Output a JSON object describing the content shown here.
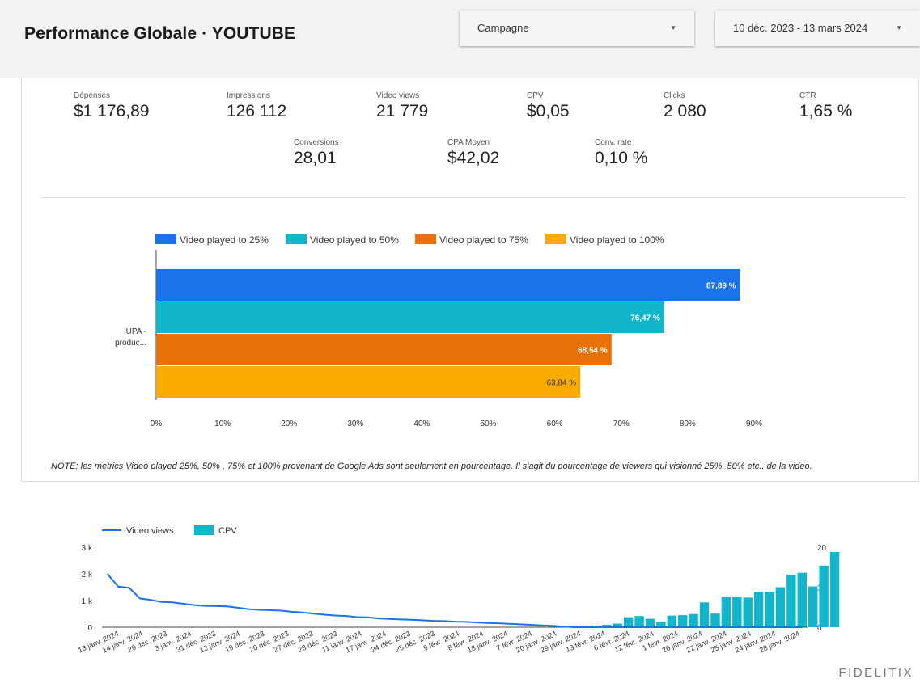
{
  "header": {
    "title": "Performance Globale · YOUTUBE",
    "campaign_dropdown": "Campagne",
    "date_dropdown": "10 déc. 2023 - 13 mars 2024"
  },
  "kpis": [
    {
      "label": "Dépenses",
      "value": "$1 176,89"
    },
    {
      "label": "Impressions",
      "value": "126 112"
    },
    {
      "label": "Video views",
      "value": "21 779"
    },
    {
      "label": "CPV",
      "value": "$0,05"
    },
    {
      "label": "Clicks",
      "value": "2 080"
    },
    {
      "label": "CTR",
      "value": "1,65 %"
    },
    {
      "label": "Conversions",
      "value": "28,01"
    },
    {
      "label": "CPA Moyen",
      "value": "$42,02"
    },
    {
      "label": "Conv. rate",
      "value": "0,10 %"
    }
  ],
  "note": "NOTE: les metrics Video played 25%, 50% , 75% et 100% provenant de Google Ads sont seulement en pourcentage. Il s'agit du pourcentage de viewers qui visionné 25%, 50% etc.. de la video.",
  "brand": "FIDELITIX",
  "chart_data": [
    {
      "type": "bar",
      "orientation": "horizontal",
      "categories": [
        "UPA - produc..."
      ],
      "series": [
        {
          "name": "Video played to 25%",
          "values": [
            87.89
          ],
          "label": "87,89 %",
          "color": "#1a73e8"
        },
        {
          "name": "Video played to 50%",
          "values": [
            76.47
          ],
          "label": "76,47 %",
          "color": "#12b5cb"
        },
        {
          "name": "Video played to 75%",
          "values": [
            68.54
          ],
          "label": "68,54 %",
          "color": "#e8710a"
        },
        {
          "name": "Video played to 100%",
          "values": [
            63.84
          ],
          "label": "63,84 %",
          "color": "#f9ab00"
        }
      ],
      "xlim": [
        0,
        90
      ],
      "xticks": [
        "0%",
        "10%",
        "20%",
        "30%",
        "40%",
        "50%",
        "60%",
        "70%",
        "80%",
        "90%"
      ],
      "legend": "top"
    },
    {
      "type": "combo",
      "categories": [
        "13 janv. 2024",
        "14 janv. 2024",
        "29 déc. 2023",
        "3 janv. 2024",
        "31 déc. 2023",
        "12 janv. 2024",
        "19 déc. 2023",
        "20 déc. 2023",
        "27 déc. 2023",
        "28 déc. 2023",
        "11 janv. 2024",
        "17 janv. 2024",
        "24 déc. 2023",
        "25 déc. 2023",
        "9 févr. 2024",
        "8 févr. 2024",
        "18 janv. 2024",
        "7 févr. 2024",
        "20 janv. 2024",
        "29 janv. 2024",
        "13 févr. 2024",
        "6 févr. 2024",
        "12 févr. 2024",
        "1 févr. 2024",
        "26 janv. 2024",
        "22 janv. 2024",
        "25 janv. 2024",
        "24 janv. 2024",
        "28 janv. 2024"
      ],
      "series": [
        {
          "name": "Video views",
          "type": "line",
          "axis": "left",
          "color": "#1a73e8",
          "values": [
            2000,
            1520,
            1480,
            1080,
            1020,
            950,
            930,
            880,
            830,
            800,
            790,
            780,
            730,
            680,
            650,
            640,
            620,
            580,
            550,
            510,
            470,
            440,
            420,
            380,
            370,
            330,
            310,
            290,
            280,
            260,
            240,
            230,
            210,
            200,
            180,
            160,
            150,
            130,
            110,
            90,
            70,
            50,
            20,
            0,
            0,
            0,
            0,
            0,
            0,
            0,
            0,
            0,
            0,
            0,
            0,
            0,
            0,
            0,
            0,
            0,
            0,
            0,
            0,
            0,
            0
          ]
        },
        {
          "name": "CPV",
          "type": "bar",
          "axis": "right",
          "color": "#12b5cb",
          "values": [
            0,
            0,
            0,
            0,
            0,
            0,
            0,
            0,
            0,
            0,
            0,
            0,
            0,
            0,
            0,
            0,
            0,
            0,
            0,
            0,
            0,
            0,
            0,
            0,
            0,
            0,
            0,
            0,
            0,
            0,
            0,
            0,
            0,
            0,
            0,
            0,
            0,
            0,
            0.05,
            0.1,
            0.15,
            0.2,
            0.25,
            0.3,
            0.3,
            0.4,
            0.6,
            0.9,
            2.5,
            2.8,
            2.1,
            1.4,
            2.9,
            3.0,
            3.3,
            6.2,
            3.4,
            7.6,
            7.6,
            7.4,
            8.8,
            8.7,
            10.0,
            13.1,
            13.6,
            10.2,
            15.4,
            18.8
          ]
        }
      ],
      "yleft": {
        "ticks": [
          "0",
          "1 k",
          "2 k",
          "3 k"
        ],
        "max": 3000
      },
      "yright": {
        "ticks": [
          "0",
          "10",
          "20"
        ],
        "max": 20
      },
      "legend": "top-left"
    }
  ]
}
